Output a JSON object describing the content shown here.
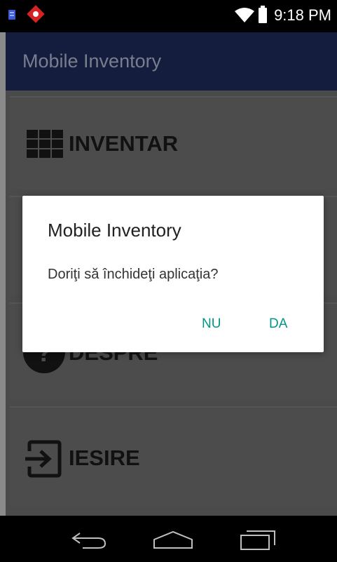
{
  "status_bar": {
    "time": "9:18 PM",
    "icons": [
      "notification-icon",
      "app-alert-icon",
      "wifi-icon",
      "battery-icon"
    ]
  },
  "app_bar": {
    "title": "Mobile Inventory"
  },
  "menu": {
    "items": [
      {
        "label": "INVENTAR",
        "icon": "grid-icon"
      },
      {
        "label": "",
        "icon": ""
      },
      {
        "label": "DESPRE",
        "icon": "help-icon"
      },
      {
        "label": "IESIRE",
        "icon": "exit-icon"
      }
    ]
  },
  "dialog": {
    "title": "Mobile Inventory",
    "message": "Doriţi să închideţi aplicaţia?",
    "negative_label": "NU",
    "positive_label": "DA"
  },
  "nav_bar": {
    "icons": [
      "back-icon",
      "home-icon",
      "recents-icon"
    ]
  },
  "colors": {
    "status_bar": "#000000",
    "app_bar": "#141d3e",
    "dim_background": "#4a4a4a",
    "dialog_background": "#ffffff",
    "dialog_button": "#009688"
  }
}
